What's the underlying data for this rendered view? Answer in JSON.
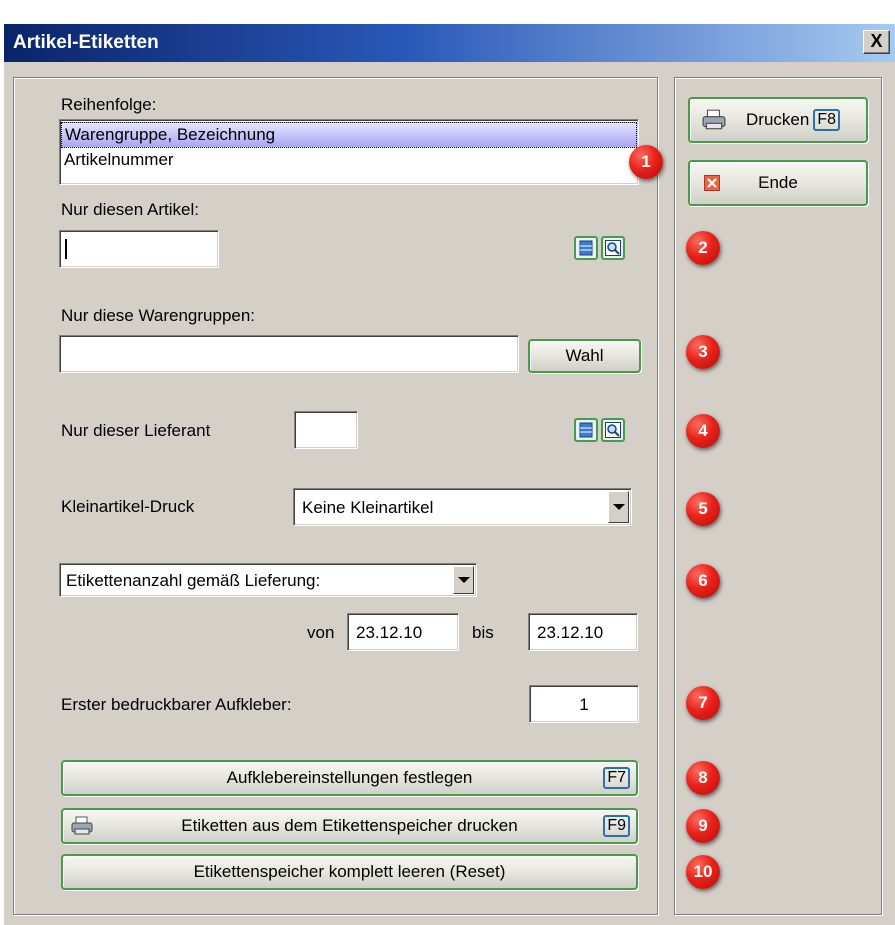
{
  "window": {
    "title": "Artikel-Etiketten",
    "close_label": "X"
  },
  "order": {
    "label": "Reihenfolge:",
    "items": [
      {
        "label": "Warengruppe, Bezeichnung"
      },
      {
        "label": "Artikelnummer"
      }
    ]
  },
  "article": {
    "label": "Nur diesen Artikel:",
    "value": ""
  },
  "groups": {
    "label": "Nur diese Warengruppen:",
    "value": "",
    "choose_label": "Wahl"
  },
  "supplier": {
    "label": "Nur dieser Lieferant",
    "value": ""
  },
  "small": {
    "label": "Kleinartikel-Druck",
    "selected": "Keine Kleinartikel"
  },
  "count": {
    "selected": "Etikettenanzahl gemäß Lieferung:",
    "from_label": "von",
    "from_value": "23.12.10",
    "to_label": "bis",
    "to_value": "23.12.10"
  },
  "first": {
    "label": "Erster bedruckbarer Aufkleber:",
    "value": "1"
  },
  "buttons": {
    "settings": {
      "label": "Aufklebereinstellungen festlegen",
      "key": "F7"
    },
    "print_memory": {
      "label": "Etiketten aus dem Etikettenspeicher drucken",
      "key": "F9"
    },
    "reset": {
      "label": "Etikettenspeicher komplett leeren (Reset)"
    },
    "print": {
      "label": "Drucken",
      "key": "F8"
    },
    "end": {
      "label": "Ende"
    }
  },
  "badges": [
    "1",
    "2",
    "3",
    "4",
    "5",
    "6",
    "7",
    "8",
    "9",
    "10"
  ],
  "colors": {
    "accent_green": "#4a9a4a",
    "badge_red": "#e8221a",
    "title_blue": "#0a246a"
  }
}
